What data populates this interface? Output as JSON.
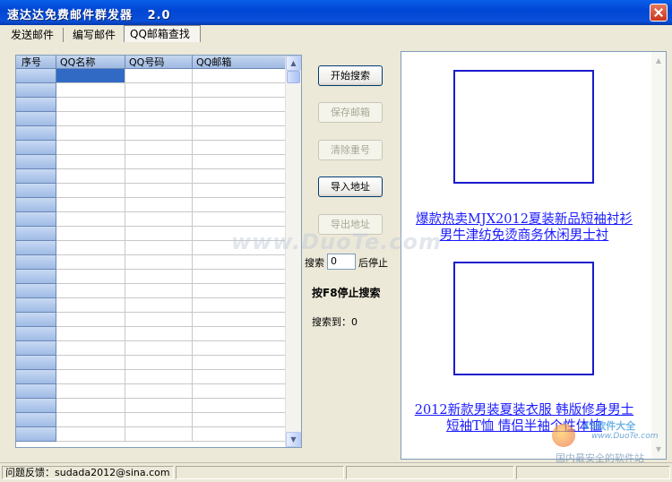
{
  "window": {
    "title": "速达达免费邮件群发器   2.0"
  },
  "tabs": [
    {
      "label": "发送邮件"
    },
    {
      "label": "编写邮件"
    },
    {
      "label": "QQ邮箱查找",
      "active": true
    }
  ],
  "grid": {
    "columns": [
      "序号",
      "QQ名称",
      "QQ号码",
      "QQ邮箱"
    ],
    "row_count": 26
  },
  "buttons": {
    "start_search": "开始搜索",
    "save_mailbox": "保存邮箱",
    "clear_duplicates": "清除重号",
    "import_address": "导入地址",
    "export_address": "导出地址"
  },
  "search": {
    "prefix": "搜索",
    "value": "0",
    "suffix": "后停止",
    "f8_hint": "按F8停止搜索",
    "found_label": "搜索到：",
    "found_count": "0"
  },
  "ads": [
    {
      "text": "爆款热卖MJX2012夏装新品短袖衬衫 男牛津纺免烫商务休闲男士衬"
    },
    {
      "text": "2012新款男装夏装衣服 韩版修身男士短袖T恤 情侣半袖个性体恤"
    }
  ],
  "watermarks": {
    "center": "www.DuoTe.com",
    "logo_brand": "45软件大全",
    "logo_url": "www.DuoTe.com",
    "logo_slogan": "国内最安全的软件站"
  },
  "statusbar": {
    "feedback": "问题反馈：sudada2012@sina.com"
  },
  "colors": {
    "titlebar": "#0a5fe8",
    "selection": "#316ac5",
    "link": "#1a1aff",
    "face": "#ece9d8"
  }
}
